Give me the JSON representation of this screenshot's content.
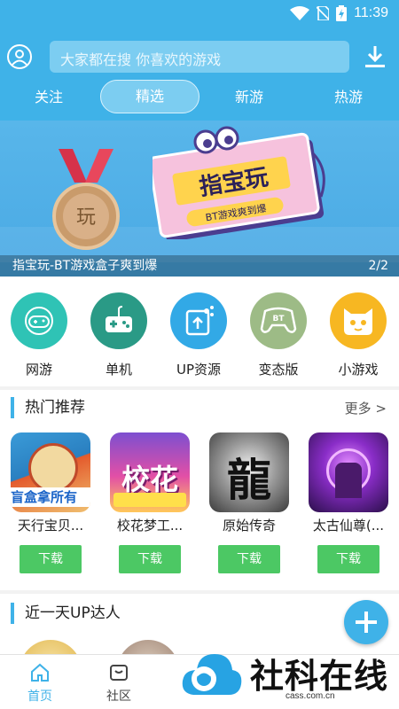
{
  "status_bar": {
    "time": "11:39"
  },
  "header": {
    "search_placeholder": "大家都在搜 你喜欢的游戏",
    "tabs": [
      {
        "label": "关注",
        "active": false
      },
      {
        "label": "精选",
        "active": true
      },
      {
        "label": "新游",
        "active": false
      },
      {
        "label": "热游",
        "active": false
      }
    ]
  },
  "banner": {
    "caption": "指宝玩-BT游戏盒子爽到爆",
    "page": "2/2",
    "board_title": "指宝玩",
    "board_sub": "BT游戏爽到爆",
    "medal_char": "玩"
  },
  "categories": [
    {
      "label": "网游",
      "icon": "gamepad-icon",
      "color": "#2fc3b5"
    },
    {
      "label": "单机",
      "icon": "joystick-icon",
      "color": "#2a9a86"
    },
    {
      "label": "UP资源",
      "icon": "share-upload-icon",
      "color": "#32a9e6"
    },
    {
      "label": "变态版",
      "icon": "bt-controller-icon",
      "color": "#9dbb86"
    },
    {
      "label": "小游戏",
      "icon": "cat-face-icon",
      "color": "#f7b722"
    }
  ],
  "hot": {
    "title": "热门推荐",
    "more": "更多 >",
    "games": [
      {
        "name": "天行宝贝...",
        "download": "下载",
        "thumb_text": "盲盒拿所有"
      },
      {
        "name": "校花梦工...",
        "download": "下载",
        "thumb_text": "校花"
      },
      {
        "name": "原始传奇",
        "download": "下载",
        "thumb_text": "龍"
      },
      {
        "name": "太古仙尊(...",
        "download": "下载",
        "thumb_text": ""
      }
    ]
  },
  "up_section": {
    "title": "近一天UP达人"
  },
  "bottom_nav": [
    {
      "label": "首页",
      "active": true
    },
    {
      "label": "社区",
      "active": false
    }
  ],
  "watermark": {
    "title": "社科在线",
    "sub": "cass.com.cn"
  },
  "colors": {
    "primary": "#3fb2e8",
    "download_green": "#4cc864"
  }
}
